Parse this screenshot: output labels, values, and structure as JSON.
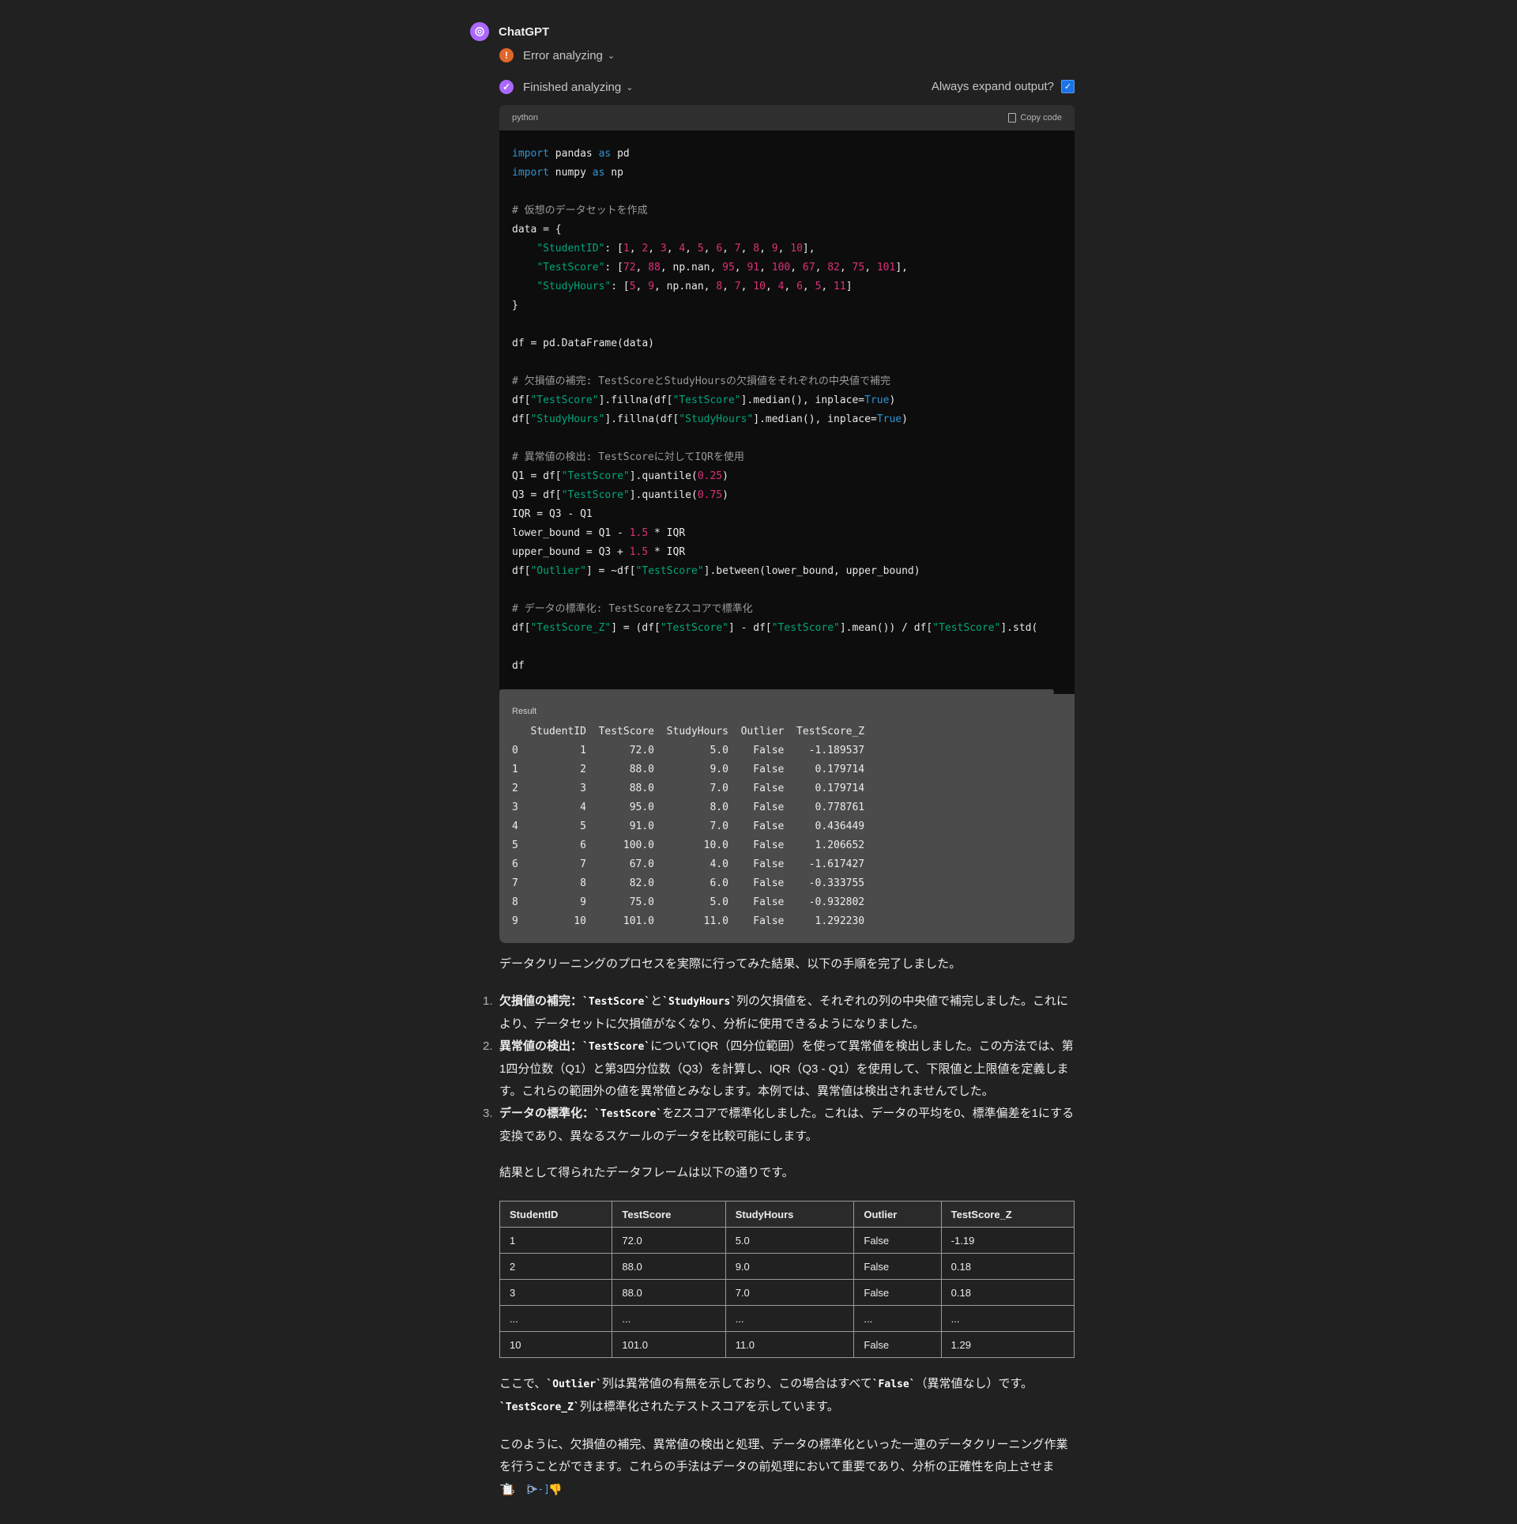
{
  "message": {
    "author": "ChatGPT",
    "status_error": "Error analyzing",
    "status_done": "Finished analyzing",
    "expand_label": "Always expand output?",
    "expand_checked": true
  },
  "code_block": {
    "language": "python",
    "copy_label": "Copy code",
    "lines": [
      "import pandas as pd",
      "import numpy as np",
      "",
      "# 仮想のデータセットを作成",
      "data = {",
      "    \"StudentID\": [1, 2, 3, 4, 5, 6, 7, 8, 9, 10],",
      "    \"TestScore\": [72, 88, np.nan, 95, 91, 100, 67, 82, 75, 101],",
      "    \"StudyHours\": [5, 9, np.nan, 8, 7, 10, 4, 6, 5, 11]",
      "}",
      "",
      "df = pd.DataFrame(data)",
      "",
      "# 欠損値の補完: TestScoreとStudyHoursの欠損値をそれぞれの中央値で補完",
      "df[\"TestScore\"].fillna(df[\"TestScore\"].median(), inplace=True)",
      "df[\"StudyHours\"].fillna(df[\"StudyHours\"].median(), inplace=True)",
      "",
      "# 異常値の検出: TestScoreに対してIQRを使用",
      "Q1 = df[\"TestScore\"].quantile(0.25)",
      "Q3 = df[\"TestScore\"].quantile(0.75)",
      "IQR = Q3 - Q1",
      "lower_bound = Q1 - 1.5 * IQR",
      "upper_bound = Q3 + 1.5 * IQR",
      "df[\"Outlier\"] = ~df[\"TestScore\"].between(lower_bound, upper_bound)",
      "",
      "# データの標準化: TestScoreをZスコアで標準化",
      "df[\"TestScore_Z\"] = (df[\"TestScore\"] - df[\"TestScore\"].mean()) / df[\"TestScore\"].std(",
      "",
      "df"
    ]
  },
  "result": {
    "label": "Result",
    "columns": [
      "StudentID",
      "TestScore",
      "StudyHours",
      "Outlier",
      "TestScore_Z"
    ],
    "rows": [
      [
        "0",
        "1",
        "72.0",
        "5.0",
        "False",
        "-1.189537"
      ],
      [
        "1",
        "2",
        "88.0",
        "9.0",
        "False",
        "0.179714"
      ],
      [
        "2",
        "3",
        "88.0",
        "7.0",
        "False",
        "0.179714"
      ],
      [
        "3",
        "4",
        "95.0",
        "8.0",
        "False",
        "0.778761"
      ],
      [
        "4",
        "5",
        "91.0",
        "7.0",
        "False",
        "0.436449"
      ],
      [
        "5",
        "6",
        "100.0",
        "10.0",
        "False",
        "1.206652"
      ],
      [
        "6",
        "7",
        "67.0",
        "4.0",
        "False",
        "-1.617427"
      ],
      [
        "7",
        "8",
        "82.0",
        "6.0",
        "False",
        "-0.333755"
      ],
      [
        "8",
        "9",
        "75.0",
        "5.0",
        "False",
        "-0.932802"
      ],
      [
        "9",
        "10",
        "101.0",
        "11.0",
        "False",
        "1.292230"
      ]
    ]
  },
  "response": {
    "intro": "データクリーニングのプロセスを実際に行ってみた結果、以下の手順を完了しました。",
    "steps": [
      {
        "n": "1.",
        "title": "欠損値の補完：",
        "code": "`TestScore`",
        "mid": "と",
        "code2": "`StudyHours`",
        "text": "列の欠損値を、それぞれの列の中央値で補完しました。これにより、データセットに欠損値がなくなり、分析に使用できるようになりました。"
      },
      {
        "n": "2.",
        "title": "異常値の検出：",
        "code": "`TestScore`",
        "text": "についてIQR（四分位範囲）を使って異常値を検出しました。この方法では、第1四分位数（Q1）と第3四分位数（Q3）を計算し、IQR（Q3 - Q1）を使用して、下限値と上限値を定義します。これらの範囲外の値を異常値とみなします。本例では、異常値は検出されませんでした。"
      },
      {
        "n": "3.",
        "title": "データの標準化：",
        "code": "`TestScore`",
        "text": "をZスコアで標準化しました。これは、データの平均を0、標準偏差を1にする変換であり、異なるスケールのデータを比較可能にします。"
      }
    ],
    "table_intro": "結果として得られたデータフレームは以下の通りです。",
    "table": {
      "headers": [
        "StudentID",
        "TestScore",
        "StudyHours",
        "Outlier",
        "TestScore_Z"
      ],
      "rows": [
        [
          "1",
          "72.0",
          "5.0",
          "False",
          "-1.19"
        ],
        [
          "2",
          "88.0",
          "9.0",
          "False",
          "0.18"
        ],
        [
          "3",
          "88.0",
          "7.0",
          "False",
          "0.18"
        ],
        [
          "...",
          "...",
          "...",
          "...",
          "..."
        ],
        [
          "10",
          "101.0",
          "11.0",
          "False",
          "1.29"
        ]
      ]
    },
    "note_code1": "`Outlier`",
    "note_text1": "列は異常値の有無を示しており、この場合はすべて",
    "note_code2": "`False`",
    "note_text2": "（異常値なし）です。",
    "note_prefix": "ここで、",
    "note_code3": "`TestScore_Z`",
    "note_text3": "列は標準化されたテストスコアを示しています。",
    "conclusion": "このように、欠損値の補完、異常値の検出と処理、データの標準化といった一連のデータクリーニング作業を行うことができます。これらの手法はデータの前処理において重要であり、分析の正確性を向上させます。",
    "cite": "[>-]"
  },
  "colors": {
    "error": "#e0662a",
    "done": "#ab68ff",
    "checkbox": "#1a73e8"
  },
  "icons": [
    "chatgpt-logo-icon",
    "error-icon",
    "check-icon",
    "chevron-down-icon",
    "copy-icon",
    "regenerate-icon",
    "thumbs-down-icon"
  ]
}
